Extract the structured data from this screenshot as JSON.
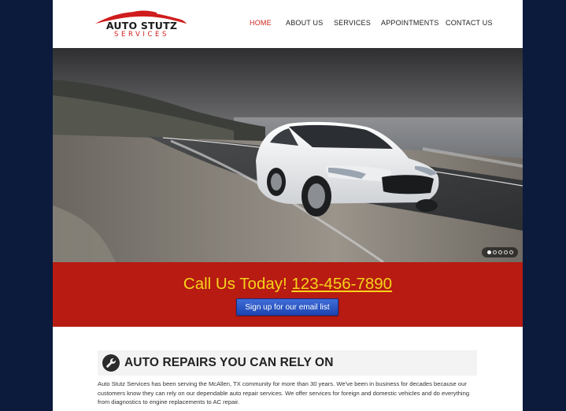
{
  "logo": {
    "main": "AUTO STUTZ",
    "sub": "SERVICES"
  },
  "nav": {
    "items": [
      {
        "label": "HOME",
        "active": true
      },
      {
        "label": "ABOUT US",
        "active": false
      },
      {
        "label": "SERVICES",
        "active": false
      },
      {
        "label": "APPOINTMENTS",
        "active": false
      },
      {
        "label": "CONTACT US",
        "active": false
      }
    ]
  },
  "hero": {
    "slide_count": 5,
    "current_slide": 1
  },
  "call": {
    "prefix": "Call Us Today!",
    "phone": "123-456-7890",
    "button_label": "Sign up for our email list"
  },
  "section": {
    "icon": "wrench-icon",
    "title": "AUTO REPAIRS YOU CAN RELY ON",
    "body": "Auto Stutz Services has been serving the McAllen, TX community for more than 30 years. We've been in business for decades because our customers know they can rely on our dependable auto repair services. We offer services for foreign and domestic vehicles and do everything from diagnostics to engine replacements to AC repair."
  },
  "colors": {
    "page_bg": "#0c1a3c",
    "accent_red": "#b81b12",
    "phone_yellow": "#f6d31a",
    "button_blue": "#2a55c4",
    "nav_active": "#d0241c"
  }
}
